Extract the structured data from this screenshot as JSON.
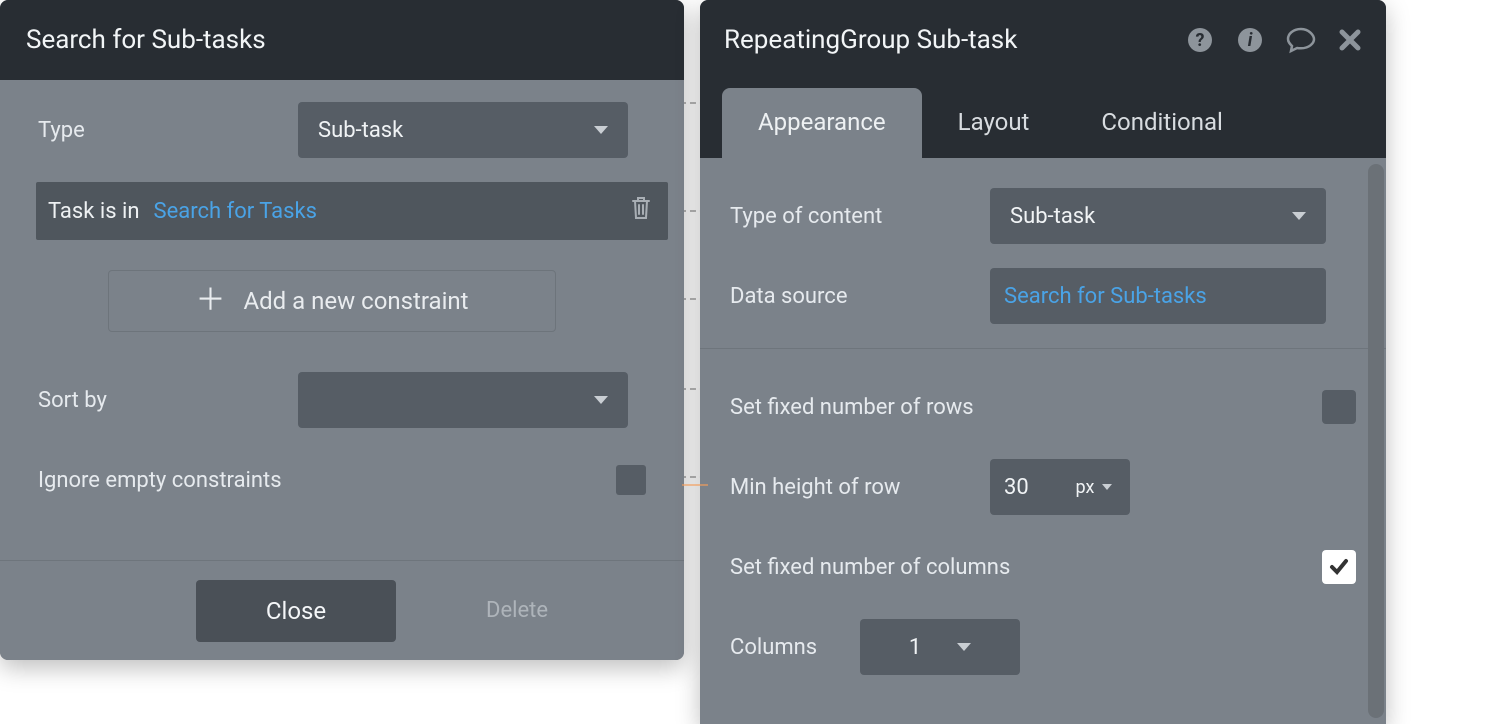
{
  "left": {
    "title": "Search for Sub-tasks",
    "type_label": "Type",
    "type_value": "Sub-task",
    "constraint_prefix": "Task is in",
    "constraint_link": "Search for Tasks",
    "add_constraint": "Add a new constraint",
    "sort_label": "Sort by",
    "sort_value": "",
    "ignore_empty_label": "Ignore empty constraints",
    "ignore_empty_checked": false,
    "close_label": "Close",
    "delete_label": "Delete"
  },
  "right": {
    "title": "RepeatingGroup Sub-task",
    "tabs": {
      "appearance": "Appearance",
      "layout": "Layout",
      "conditional": "Conditional"
    },
    "active_tab": "appearance",
    "type_of_content_label": "Type of content",
    "type_of_content_value": "Sub-task",
    "data_source_label": "Data source",
    "data_source_value": "Search for Sub-tasks",
    "fixed_rows_label": "Set fixed number of rows",
    "fixed_rows_checked": false,
    "min_height_label": "Min height of row",
    "min_height_value": "30",
    "min_height_unit": "px",
    "fixed_cols_label": "Set fixed number of columns",
    "fixed_cols_checked": true,
    "columns_label": "Columns",
    "columns_value": "1"
  },
  "colors": {
    "panel_bg": "#7b828a",
    "header_bg": "#282d33",
    "control_bg": "#565d65",
    "link": "#4aa3e6"
  }
}
